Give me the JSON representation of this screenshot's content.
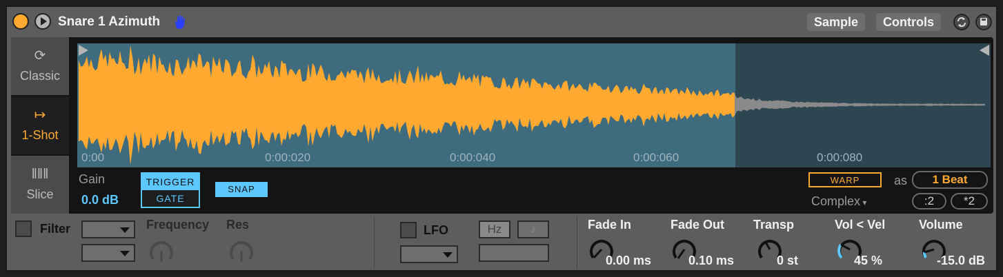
{
  "device": {
    "name": "Snare 1 Azimuth",
    "tabs": [
      "Sample",
      "Controls"
    ]
  },
  "modes": [
    {
      "label": "Classic",
      "icon": "loop-icon"
    },
    {
      "label": "1-Shot",
      "icon": "one-shot-icon"
    },
    {
      "label": "Slice",
      "icon": "slice-icon"
    }
  ],
  "waveform": {
    "time_markers": [
      "0:00",
      "0:00:020",
      "0:00:040",
      "0:00:060",
      "0:00:080"
    ]
  },
  "sample_controls": {
    "gain_label": "Gain",
    "gain_value": "0.0 dB",
    "trigger_label": "TRIGGER",
    "gate_label": "GATE",
    "snap_label": "SNAP",
    "warp_label": "WARP",
    "as_label": "as",
    "beat_value": "1 Beat",
    "warp_mode": "Complex",
    "half_label": ":2",
    "double_label": "*2"
  },
  "filter": {
    "label": "Filter",
    "frequency_label": "Frequency",
    "res_label": "Res"
  },
  "lfo": {
    "label": "LFO",
    "hz_label": "Hz",
    "note_label": "♪"
  },
  "envelope": {
    "fade_in_label": "Fade In",
    "fade_in_value": "0.00 ms",
    "fade_out_label": "Fade Out",
    "fade_out_value": "0.10 ms",
    "transp_label": "Transp",
    "transp_value": "0 st",
    "vol_vel_label": "Vol < Vel",
    "vol_vel_value": "45 %",
    "volume_label": "Volume",
    "volume_value": "-15.0 dB"
  },
  "colors": {
    "accent_orange": "#ffa931",
    "accent_blue": "#5cc8ff",
    "wave_bg": "#3e6b7e"
  }
}
